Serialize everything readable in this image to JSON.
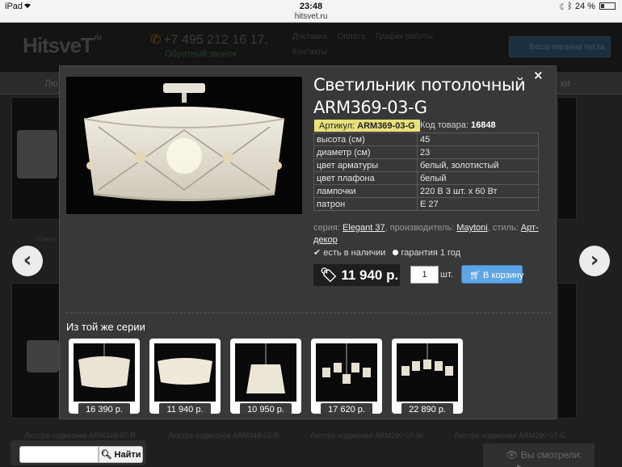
{
  "statusbar": {
    "device": "iPad",
    "time": "23:48",
    "url": "hitsvet.ru",
    "battery": "24 %",
    "battery_level": 0.24
  },
  "site": {
    "logo": "HitsveT",
    "logo_suffix": ".ru",
    "phone": "+7 495 212 16 17.",
    "callback": "Обратный звонок",
    "links": [
      "Доставка",
      "Оплата",
      "График работы",
      "Контакты"
    ],
    "cart": "Ваша корзина пуста",
    "nav_left": "Лю",
    "nav_right": "ки",
    "bg_left_label": "Свети",
    "captions": [
      "Люстра подвесная ARM348-07-R",
      "Люстра подвесная ARM348-05-R",
      "Люстра подвесная ARM290-07-W",
      "Люстра подвесная ARM290-07-G"
    ]
  },
  "search": {
    "placeholder": "",
    "button": "Найти"
  },
  "viewed": "Вы смотрели:",
  "modal": {
    "close": "×",
    "title": "Светильник потолочный ARM369-03-G",
    "article_label": "Артикул:",
    "article": "ARM369-03-G",
    "code_label": "Код товара:",
    "code": "16848",
    "specs": [
      {
        "k": "высота (см)",
        "v": "45"
      },
      {
        "k": "диаметр (см)",
        "v": "23"
      },
      {
        "k": "цвет арматуры",
        "v": "белый, золотистый"
      },
      {
        "k": "цвет плафона",
        "v": "белый"
      },
      {
        "k": "лампочки",
        "v": "220 В 3 шт. x 60 Вт"
      },
      {
        "k": "патрон",
        "v": "E 27"
      }
    ],
    "series_label": "серия:",
    "series": "Elegant 37",
    "maker_label": "производитель:",
    "maker": "Maytoni",
    "style_label": "стиль:",
    "style": "Арт-декор",
    "in_stock": "есть в наличии",
    "warranty": "гарантия 1 год",
    "price": "11 940 р.",
    "qty": "1",
    "qty_unit": "шт.",
    "buy": "В корзину",
    "series_title": "Из той же серии",
    "related": [
      {
        "price": "16 390 р."
      },
      {
        "price": "11 940 р."
      },
      {
        "price": "10 950 р."
      },
      {
        "price": "17 620 р."
      },
      {
        "price": "22 890 р."
      }
    ]
  },
  "colors": {
    "accent": "#5ea5e6",
    "badge": "#e8e07a",
    "modal_bg": "#383838"
  }
}
